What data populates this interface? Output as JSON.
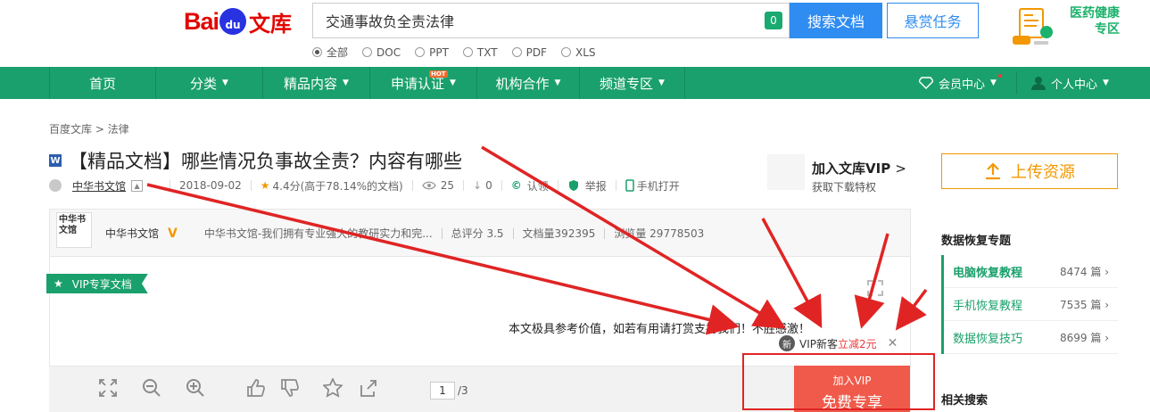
{
  "header": {
    "logo_bai": "Bai",
    "logo_du": "du",
    "logo_wenku": "文库",
    "search_value": "交通事故负全责法律",
    "search_count": "0",
    "search_button": "搜索文档",
    "reward_button": "悬赏任务",
    "filetypes": [
      "全部",
      "DOC",
      "PPT",
      "TXT",
      "PDF",
      "XLS"
    ],
    "promo_line1": "医药健康",
    "promo_line2": "专区"
  },
  "nav": {
    "items": [
      "首页",
      "分类",
      "精品内容",
      "申请认证",
      "机构合作",
      "频道专区"
    ],
    "hot_badge": "HOT",
    "vip_center": "会员中心",
    "personal_center": "个人中心"
  },
  "doc": {
    "breadcrumb": "百度文库 > 法律",
    "title": "【精品文档】哪些情况负事故全责？内容有哪些",
    "file_icon": "W",
    "author": "中华书文馆",
    "date": "2018-09-02",
    "rating": "4.4分(高于78.14%的文档)",
    "views": "25",
    "downloads": "0",
    "claim": "认领",
    "report": "举报",
    "mobile_open": "手机打开",
    "join_vip_title": "加入文库VIP",
    "join_vip_sub": "获取下载特权"
  },
  "author_bar": {
    "avatar_text": "中华书文馆",
    "name": "中华书文馆",
    "desc": "中华书文馆-我们拥有专业强大的教研实力和完...",
    "score": "总评分 3.5",
    "doc_count": "文档量392395",
    "view_count": "浏览量 29778503"
  },
  "viewer": {
    "ribbon": "VIP专享文档",
    "notice": "本文极具参考价值，如若有用请打赏支持我们！不胜感激！",
    "newuser_badge": "新",
    "newuser_text": "VIP新客",
    "newuser_discount": "立减2元",
    "page_current": "1",
    "page_total": "/3",
    "vip_free_line1": "加入VIP",
    "vip_free_line2": "免费专享"
  },
  "sidebar": {
    "upload": "上传资源",
    "section_title": "数据恢复专题",
    "items": [
      {
        "name": "电脑恢复教程",
        "count": "8474",
        "unit": "篇"
      },
      {
        "name": "手机恢复教程",
        "count": "7535",
        "unit": "篇"
      },
      {
        "name": "数据恢复技巧",
        "count": "8699",
        "unit": "篇"
      }
    ],
    "related_title": "相关搜索"
  },
  "colors": {
    "nav_green": "#1aa06c",
    "search_blue": "#2f8cf0",
    "upload_orange": "#f39800",
    "vip_red": "#f05a4a",
    "annotation_red": "#e02424"
  }
}
